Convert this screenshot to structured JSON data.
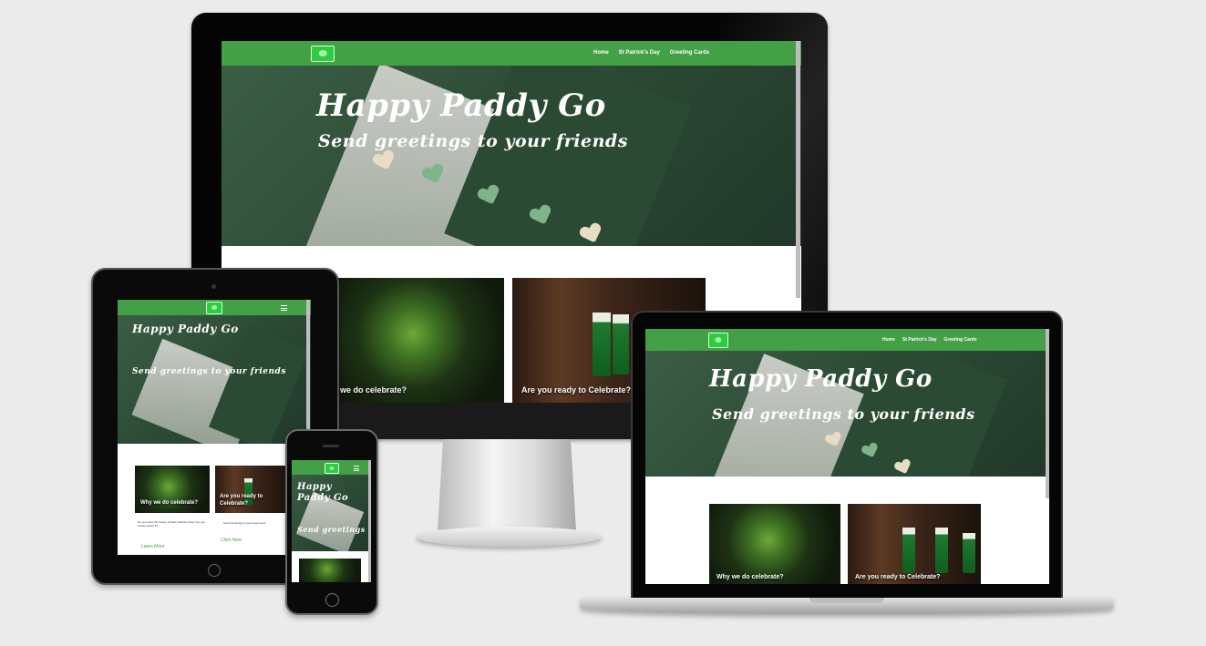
{
  "site": {
    "nav": {
      "home": "Home",
      "st_patricks": "St Patrick's Day",
      "greeting_cards": "Greeting Cards"
    },
    "hero": {
      "title": "Happy Paddy Go",
      "subtitle": "Send greetings to your friends"
    },
    "cards": [
      {
        "title": "Why we do celebrate?",
        "text": "Do you know the history of Saint Patrick's Day? Are you curious about it?",
        "link": "Learn More"
      },
      {
        "title": "Are you ready to Celebrate?",
        "text": "Send Greetings to your loved ones",
        "link": "Click Here"
      }
    ],
    "desktop_tile_caption_1": "we do celebrate?",
    "tablet_card_1_text": "Do you know the history of Saint Patrick's Day? Are you curious about it?",
    "tablet_card_2_text": "Send Greetings to your loved ones",
    "phone_hero_title": "Happy Paddy Go"
  },
  "colors": {
    "nav_green": "#43a047",
    "accent": "#43a047",
    "background": "#ebebeb"
  },
  "icons": [
    "logo-icon",
    "hamburger-menu-icon",
    "home-button-icon"
  ]
}
